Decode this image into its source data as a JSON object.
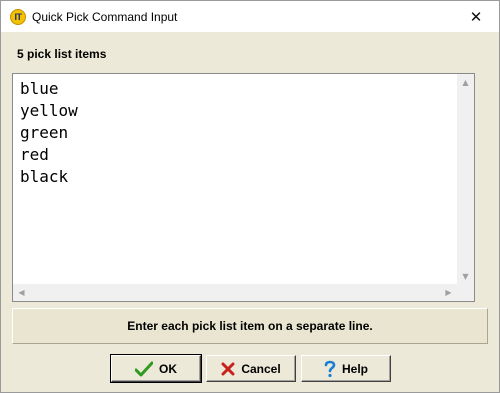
{
  "window": {
    "title": "Quick Pick Command Input",
    "app_icon_text": "IT",
    "close_glyph": "✕"
  },
  "count_label": "5 pick list items",
  "pick_list": {
    "items": [
      "blue",
      "yellow",
      "green",
      "red",
      "black"
    ]
  },
  "scroll": {
    "up": "▲",
    "down": "▼",
    "left": "◀",
    "right": "▶"
  },
  "hint": "Enter each pick list item on a separate line.",
  "buttons": {
    "ok": {
      "label": "OK",
      "icon": "checkmark-icon",
      "color": "#2e9a1f"
    },
    "cancel": {
      "label": "Cancel",
      "icon": "x-mark-icon",
      "color": "#c8201a"
    },
    "help": {
      "label": "Help",
      "icon": "question-mark-icon",
      "color": "#1a7fd4"
    }
  }
}
